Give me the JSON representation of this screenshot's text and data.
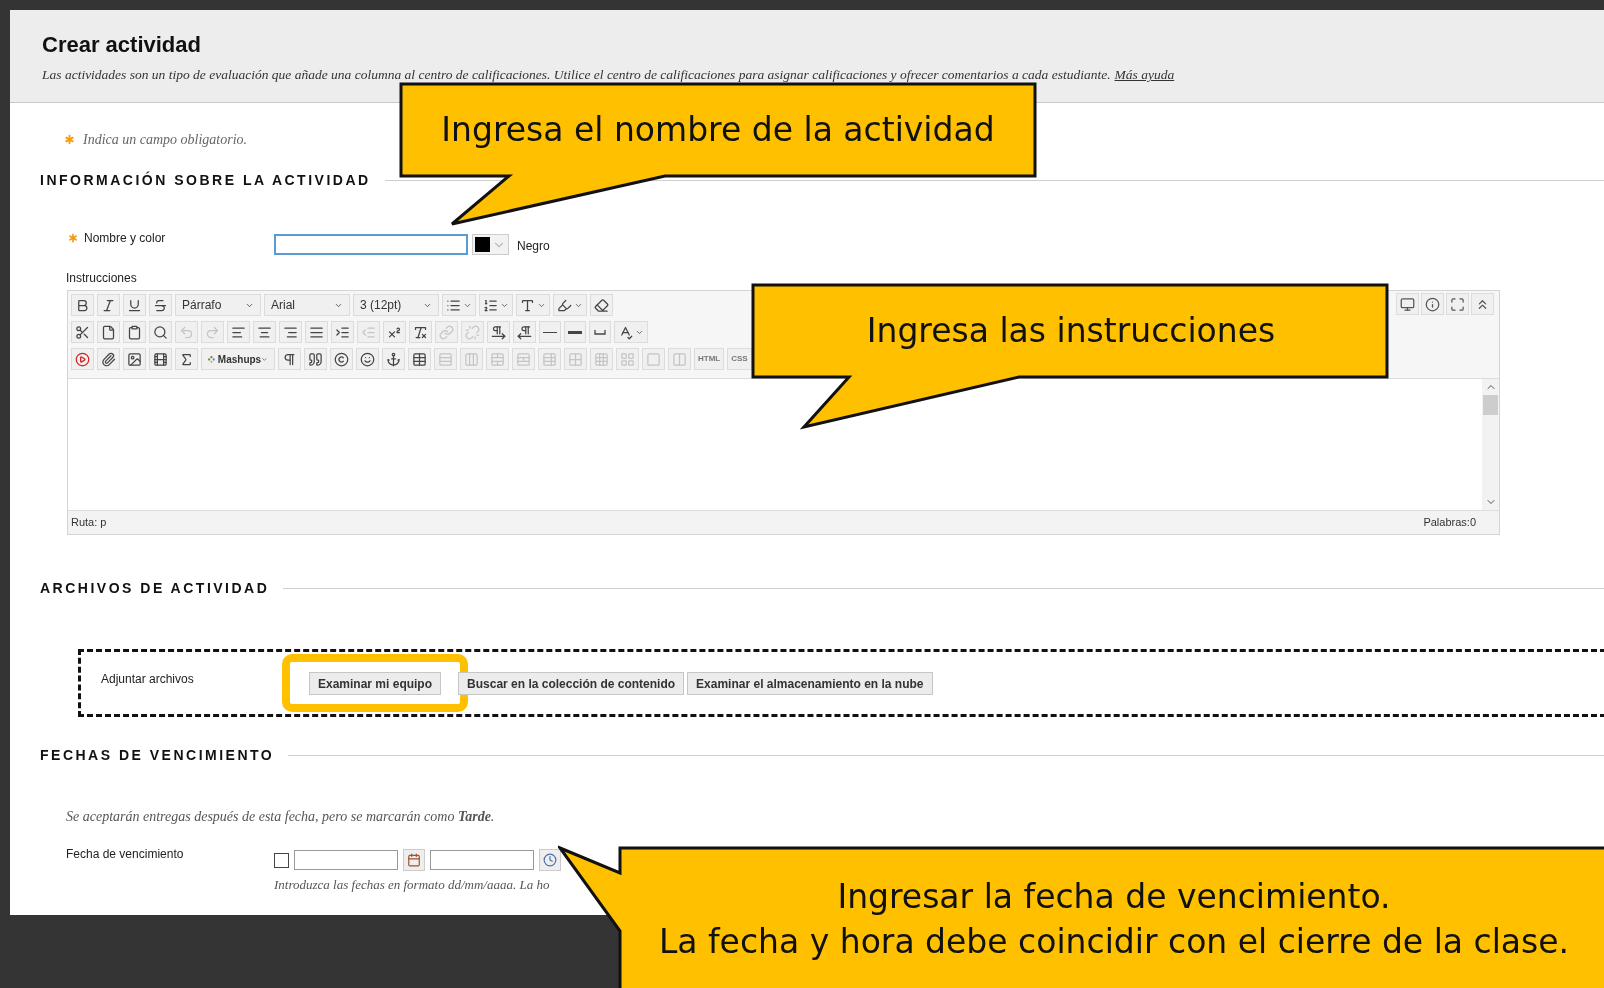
{
  "header": {
    "title": "Crear actividad",
    "description": "Las actividades son un tipo de evaluación que añade una columna al centro de calificaciones. Utilice el centro de calificaciones para asignar calificaciones y ofrecer comentarios a cada estudiante.",
    "help_link": "Más ayuda"
  },
  "required_note": "Indica un campo obligatorio.",
  "info_section": {
    "heading": "INFORMACIÓN SOBRE LA ACTIVIDAD",
    "name_field": {
      "label": "Nombre y color",
      "required": true,
      "color_name": "Negro"
    },
    "instructions": {
      "label": "Instrucciones",
      "toolbar": [
        [
          {
            "kind": "icon",
            "disabled": false
          },
          {
            "kind": "icon",
            "disabled": false
          },
          {
            "kind": "icon",
            "disabled": false
          },
          {
            "kind": "icon",
            "disabled": false
          },
          {
            "kind": "select",
            "label": "Párrafo"
          },
          {
            "kind": "select",
            "label": "Arial"
          },
          {
            "kind": "select",
            "label": "3 (12pt)"
          },
          {
            "kind": "menu_icon",
            "disabled": false
          },
          {
            "kind": "menu_icon",
            "disabled": false
          },
          {
            "kind": "menu_icon",
            "disabled": false
          },
          {
            "kind": "menu_icon",
            "disabled": false
          },
          {
            "kind": "icon",
            "disabled": false
          }
        ],
        [
          {
            "kind": "icon",
            "disabled": false
          },
          {
            "kind": "icon",
            "disabled": false
          },
          {
            "kind": "icon",
            "disabled": false
          },
          {
            "kind": "icon",
            "disabled": false
          },
          {
            "kind": "icon",
            "disabled": true
          },
          {
            "kind": "icon",
            "disabled": true
          },
          {
            "kind": "icon",
            "disabled": false
          },
          {
            "kind": "icon",
            "disabled": false
          },
          {
            "kind": "icon",
            "disabled": false
          },
          {
            "kind": "icon",
            "disabled": false
          },
          {
            "kind": "icon",
            "disabled": false
          },
          {
            "kind": "icon",
            "disabled": true
          },
          {
            "kind": "icon",
            "disabled": false
          },
          {
            "kind": "icon",
            "disabled": false
          },
          {
            "kind": "icon",
            "disabled": true
          },
          {
            "kind": "icon",
            "disabled": true
          },
          {
            "kind": "icon",
            "disabled": false
          },
          {
            "kind": "icon",
            "disabled": false
          },
          {
            "kind": "icon",
            "disabled": false
          },
          {
            "kind": "icon",
            "disabled": false
          },
          {
            "kind": "icon",
            "disabled": false
          },
          {
            "kind": "menu_icon",
            "disabled": false
          }
        ],
        [
          {
            "kind": "icon",
            "disabled": false
          },
          {
            "kind": "icon",
            "disabled": false
          },
          {
            "kind": "icon",
            "disabled": false
          },
          {
            "kind": "icon",
            "disabled": false
          },
          {
            "kind": "icon",
            "disabled": false
          },
          {
            "kind": "select",
            "label": "Mashups",
            "has_icon": true
          },
          {
            "kind": "icon",
            "disabled": false
          },
          {
            "kind": "icon",
            "disabled": false
          },
          {
            "kind": "icon",
            "disabled": false
          },
          {
            "kind": "icon",
            "disabled": false
          },
          {
            "kind": "icon",
            "disabled": false
          },
          {
            "kind": "icon",
            "disabled": false
          },
          {
            "kind": "icon",
            "disabled": true
          },
          {
            "kind": "icon",
            "disabled": true
          },
          {
            "kind": "icon",
            "disabled": true
          },
          {
            "kind": "icon",
            "disabled": true
          },
          {
            "kind": "icon",
            "disabled": true
          },
          {
            "kind": "icon",
            "disabled": true
          },
          {
            "kind": "icon",
            "disabled": true
          },
          {
            "kind": "icon",
            "disabled": true
          },
          {
            "kind": "icon",
            "disabled": true
          },
          {
            "kind": "icon",
            "disabled": true
          },
          {
            "kind": "text",
            "label": "HTML"
          },
          {
            "kind": "text",
            "label": "CSS"
          }
        ]
      ],
      "path": "Ruta: p",
      "word_count": "Palabras:0"
    }
  },
  "files_section": {
    "heading": "ARCHIVOS DE ACTIVIDAD",
    "attach_label": "Adjuntar archivos",
    "buttons": [
      {
        "label": "Examinar mi equipo",
        "highlighted": true
      },
      {
        "label": "Buscar en la colección de contenido",
        "highlighted": false
      },
      {
        "label": "Examinar el almacenamiento en la nube",
        "highlighted": false
      }
    ]
  },
  "dates_section": {
    "heading": "FECHAS DE VENCIMIENTO",
    "note": "Se aceptarán entregas después de esta fecha, pero se marcarán como **Tarde**.",
    "due_label": "Fecha de vencimiento",
    "checked": false,
    "hint": "Introduzca las fechas en formato dd/mm/aaaa. La ho"
  },
  "callouts": [
    {
      "lines": [
        "Ingresa el nombre de la actividad"
      ]
    },
    {
      "lines": [
        "Ingresa las instrucciones"
      ]
    },
    {
      "lines": [
        "Ingresar la fecha de vencimiento.",
        "La fecha y hora debe coincidir con el cierre de la clase."
      ]
    }
  ]
}
